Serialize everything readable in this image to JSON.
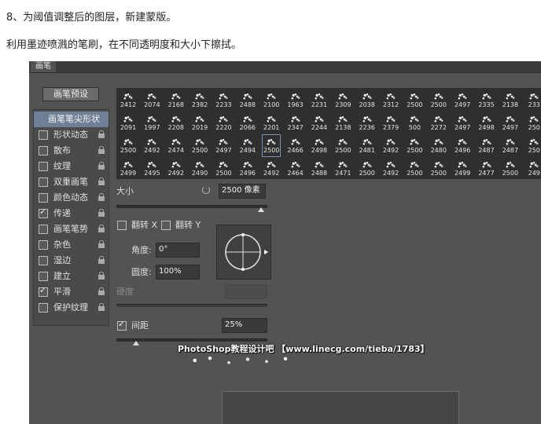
{
  "captions": {
    "step": "8、为阈值调整后的图层，新建蒙版。",
    "instruction": "利用墨迹喷溅的笔刷，在不同透明度和大小下擦拭。"
  },
  "panel": {
    "title": "画笔",
    "preset_button": "画笔预设",
    "options": [
      {
        "label": "画笔笔尖形状",
        "selected": true,
        "checkbox": false,
        "checked": false,
        "lock": false
      },
      {
        "label": "形状动态",
        "selected": false,
        "checkbox": true,
        "checked": false,
        "lock": true
      },
      {
        "label": "散布",
        "selected": false,
        "checkbox": true,
        "checked": false,
        "lock": true
      },
      {
        "label": "纹理",
        "selected": false,
        "checkbox": true,
        "checked": false,
        "lock": true
      },
      {
        "label": "双重画笔",
        "selected": false,
        "checkbox": true,
        "checked": false,
        "lock": true
      },
      {
        "label": "颜色动态",
        "selected": false,
        "checkbox": true,
        "checked": false,
        "lock": true
      },
      {
        "label": "传递",
        "selected": false,
        "checkbox": true,
        "checked": true,
        "lock": true
      },
      {
        "label": "画笔笔势",
        "selected": false,
        "checkbox": true,
        "checked": false,
        "lock": true
      },
      {
        "label": "杂色",
        "selected": false,
        "checkbox": true,
        "checked": false,
        "lock": true
      },
      {
        "label": "湿边",
        "selected": false,
        "checkbox": true,
        "checked": false,
        "lock": true
      },
      {
        "label": "建立",
        "selected": false,
        "checkbox": true,
        "checked": false,
        "lock": true
      },
      {
        "label": "平滑",
        "selected": false,
        "checkbox": true,
        "checked": true,
        "lock": true
      },
      {
        "label": "保护纹理",
        "selected": false,
        "checkbox": true,
        "checked": false,
        "lock": true
      }
    ],
    "brush_tips": [
      [
        "2412",
        "2074",
        "2168",
        "2382",
        "2233",
        "2488",
        "2100",
        "1963",
        "2231",
        "2309",
        "2038",
        "2312",
        "2500",
        "2500",
        "2497",
        "2335",
        "2138",
        "233"
      ],
      [
        "2091",
        "1997",
        "2208",
        "2019",
        "2220",
        "2066",
        "2201",
        "2347",
        "2244",
        "2138",
        "2236",
        "2379",
        "500",
        "2272",
        "2497",
        "2498",
        "2497",
        "250"
      ],
      [
        "2500",
        "2492",
        "2474",
        "2500",
        "2497",
        "2494",
        "2500",
        "2466",
        "2498",
        "2500",
        "2481",
        "2492",
        "2500",
        "2480",
        "2496",
        "2487",
        "2487",
        "250"
      ],
      [
        "2499",
        "2495",
        "2492",
        "2490",
        "2500",
        "2496",
        "2492",
        "2464",
        "2488",
        "2471",
        "2500",
        "2492",
        "2500",
        "2500",
        "2499",
        "2477",
        "2500",
        "249"
      ]
    ],
    "selected_tip": {
      "row": 2,
      "col": 6
    },
    "size": {
      "label": "大小",
      "value": "2500 像素",
      "level": 1.0
    },
    "flip_x": {
      "label": "翻转 X",
      "checked": false
    },
    "flip_y": {
      "label": "翻转 Y",
      "checked": false
    },
    "angle": {
      "label": "角度:",
      "value": "0°"
    },
    "roundness": {
      "label": "圆度:",
      "value": "100%"
    },
    "hardness": {
      "label": "硬度",
      "value": ""
    },
    "spacing": {
      "label": "间距",
      "value": "25%",
      "checked": true,
      "level": 0.25
    }
  },
  "watermark": "PhotoShop教程设计吧 【www.linecg.com/tieba/1783】"
}
